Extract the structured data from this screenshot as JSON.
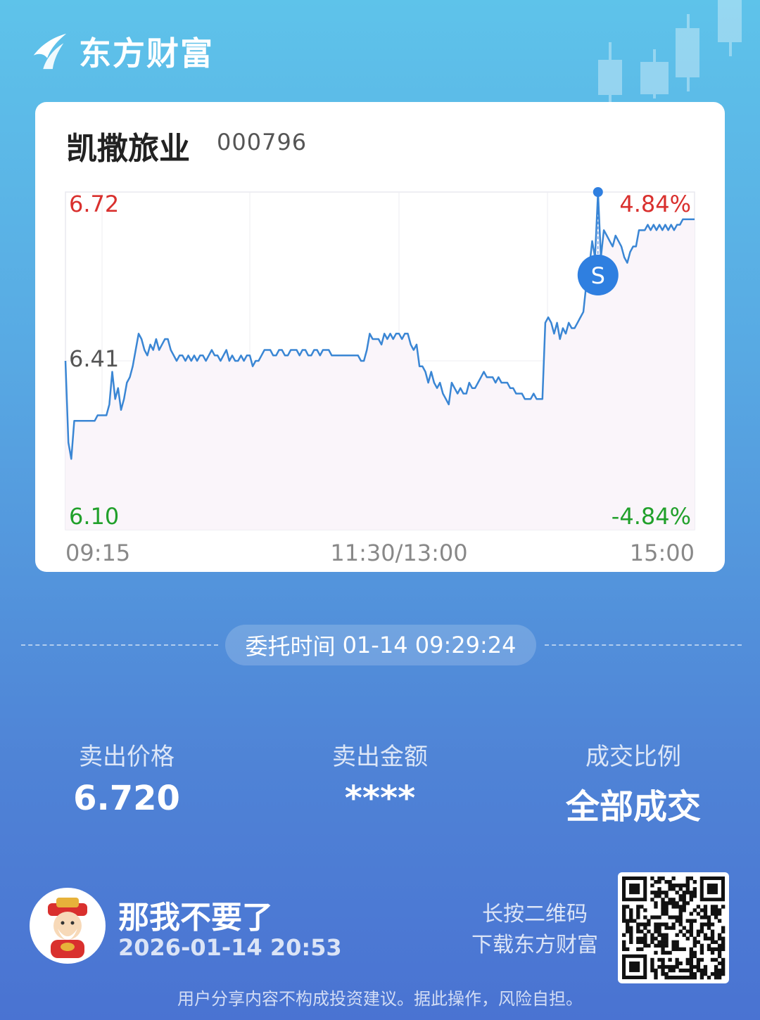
{
  "brand": {
    "name": "东方财富",
    "logo_icon": "eastmoney-logo-icon"
  },
  "stock": {
    "name": "凯撒旅业",
    "code": "000796"
  },
  "chart_data": {
    "type": "line",
    "y_top_label": "6.72",
    "y_mid_label": "6.41",
    "y_bottom_label": "6.10",
    "right_top_label": "4.84%",
    "right_bottom_label": "-4.84%",
    "x_labels": [
      "09:15",
      "11:30/13:00",
      "15:00"
    ],
    "ylim": [
      6.1,
      6.72
    ],
    "series": [
      {
        "values": [
          6.41,
          6.26,
          6.23,
          6.3,
          6.3,
          6.3,
          6.3,
          6.3,
          6.3,
          6.3,
          6.3,
          6.31,
          6.31,
          6.31,
          6.31,
          6.33,
          6.39,
          6.34,
          6.36,
          6.32,
          6.34,
          6.37,
          6.38,
          6.4,
          6.43,
          6.46,
          6.45,
          6.43,
          6.42,
          6.44,
          6.43,
          6.45,
          6.43,
          6.44,
          6.45,
          6.45,
          6.43,
          6.42,
          6.41,
          6.42,
          6.42,
          6.41,
          6.42,
          6.41,
          6.42,
          6.41,
          6.42,
          6.42,
          6.41,
          6.42,
          6.43,
          6.42,
          6.42,
          6.41,
          6.42,
          6.43,
          6.41,
          6.42,
          6.41,
          6.41,
          6.42,
          6.41,
          6.42,
          6.42,
          6.4,
          6.41,
          6.41,
          6.42,
          6.43,
          6.43,
          6.43,
          6.42,
          6.42,
          6.43,
          6.43,
          6.42,
          6.42,
          6.43,
          6.43,
          6.43,
          6.42,
          6.43,
          6.43,
          6.42,
          6.42,
          6.43,
          6.43,
          6.42,
          6.43,
          6.43,
          6.43,
          6.42,
          6.42,
          6.42,
          6.42,
          6.42,
          6.42,
          6.42,
          6.42,
          6.42,
          6.42,
          6.41,
          6.41,
          6.43,
          6.46,
          6.45,
          6.45,
          6.45,
          6.44,
          6.46,
          6.45,
          6.46,
          6.45,
          6.46,
          6.46,
          6.45,
          6.46,
          6.46,
          6.44,
          6.43,
          6.44,
          6.4,
          6.4,
          6.39,
          6.37,
          6.39,
          6.37,
          6.36,
          6.37,
          6.35,
          6.34,
          6.33,
          6.37,
          6.36,
          6.35,
          6.36,
          6.35,
          6.35,
          6.37,
          6.36,
          6.36,
          6.37,
          6.38,
          6.39,
          6.38,
          6.38,
          6.38,
          6.37,
          6.38,
          6.37,
          6.37,
          6.37,
          6.36,
          6.36,
          6.35,
          6.35,
          6.35,
          6.34,
          6.34,
          6.34,
          6.35,
          6.34,
          6.34,
          6.34,
          6.48,
          6.49,
          6.48,
          6.46,
          6.48,
          6.45,
          6.47,
          6.46,
          6.48,
          6.47,
          6.47,
          6.48,
          6.49,
          6.5,
          6.55,
          6.58,
          6.63,
          6.6,
          6.72,
          6.6,
          6.65,
          6.64,
          6.63,
          6.62,
          6.64,
          6.63,
          6.62,
          6.6,
          6.59,
          6.61,
          6.62,
          6.62,
          6.65,
          6.65,
          6.65,
          6.66,
          6.65,
          6.66,
          6.65,
          6.66,
          6.65,
          6.66,
          6.65,
          6.66,
          6.65,
          6.66,
          6.66,
          6.67,
          6.67,
          6.67,
          6.67,
          6.67
        ]
      }
    ],
    "sell_marker": {
      "label": "S",
      "price": 6.72
    }
  },
  "order_time": {
    "label": "委托时间",
    "value": "01-14 09:29:24"
  },
  "stats": [
    {
      "label": "卖出价格",
      "value": "6.720"
    },
    {
      "label": "卖出金额",
      "value": "****"
    },
    {
      "label": "成交比例",
      "value": "全部成交"
    }
  ],
  "user": {
    "name": "那我不要了",
    "time": "2026-01-14 20:53",
    "avatar_icon": "caishen-avatar-icon"
  },
  "qr": {
    "line1": "长按二维码",
    "line2": "下载东方财富"
  },
  "disclaimer": "用户分享内容不构成投资建议。据此操作，风险自担。",
  "colors": {
    "up": "#d9302e",
    "down": "#21a02b",
    "line": "#3a86d4",
    "marker": "#2f7fe0"
  }
}
